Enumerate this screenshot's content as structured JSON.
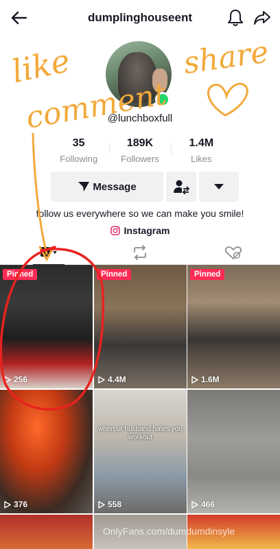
{
  "header": {
    "username": "dumplinghouseent",
    "back_icon": "back-arrow-icon",
    "bell_icon": "bell-icon",
    "share_icon": "share-arrow-icon"
  },
  "profile": {
    "handle": "@lunchboxfull",
    "online_color": "#20d56b"
  },
  "stats": [
    {
      "value": "35",
      "label": "Following"
    },
    {
      "value": "189K",
      "label": "Followers"
    },
    {
      "value": "1.4M",
      "label": "Likes"
    }
  ],
  "actions": {
    "message_label": "Message"
  },
  "bio": {
    "text": "follow us everywhere so we can make you smile!",
    "link_label": "Instagram"
  },
  "videos": [
    {
      "pinned": "Pinned",
      "views": "256"
    },
    {
      "pinned": "Pinned",
      "views": "4.4M"
    },
    {
      "pinned": "Pinned",
      "views": "1.6M"
    },
    {
      "views": "376"
    },
    {
      "views": "558",
      "caption": "when ur husband hates you workout"
    },
    {
      "views": "466"
    }
  ],
  "watermark": "OnlyFans.com/dumdumdinsyle",
  "annotations": {
    "like_text": "like",
    "comment_text": "comment",
    "share_text": "share",
    "accent_orange": "#f2a93b",
    "accent_red": "#e8231f"
  },
  "colors": {
    "pinned_badge": "#fe2c55",
    "text_primary": "#161823",
    "text_secondary": "#8a8b91",
    "button_bg": "#f1f1f2"
  }
}
